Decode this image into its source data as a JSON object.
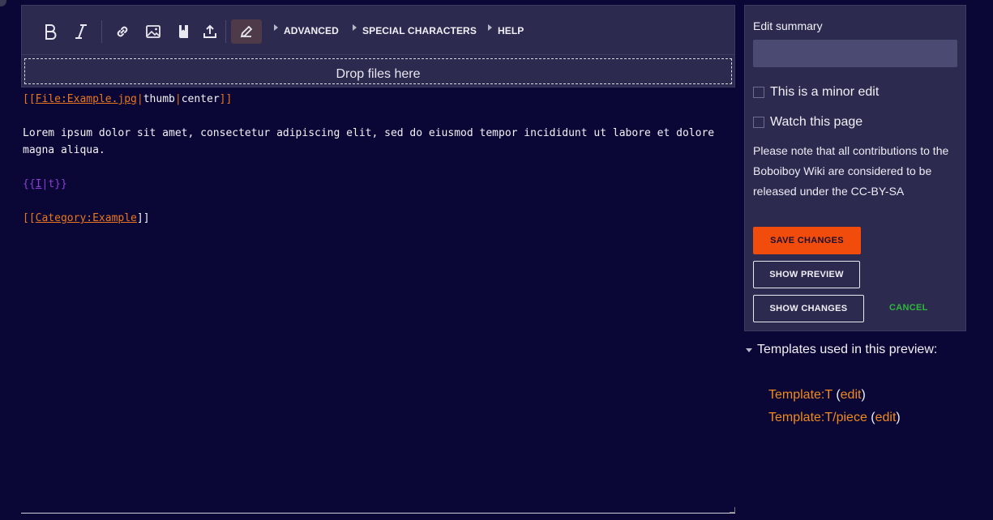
{
  "toolbar": {
    "menus": [
      "ADVANCED",
      "SPECIAL CHARACTERS",
      "HELP"
    ],
    "drop_text": "Drop files here"
  },
  "editor": {
    "line1": {
      "open": "[[",
      "link": "File:Example.jpg",
      "pipe1": "|",
      "param1": "thumb",
      "pipe2": "|",
      "param2": "center",
      "close": "]]"
    },
    "paragraph": "Lorem ipsum dolor sit amet, consectetur adipiscing elit, sed do eiusmod tempor incididunt ut labore et dolore magna aliqua.",
    "template": {
      "open": "{{",
      "name": "I",
      "pipe": "|",
      "param": "t",
      "close": "}}"
    },
    "category": {
      "open": "[[",
      "link": "Category:Example",
      "close": "]]"
    }
  },
  "panel": {
    "summary_label": "Edit summary",
    "summary_value": "",
    "minor_edit": "This is a minor edit",
    "watch_page": "Watch this page",
    "note": "Please note that all contributions to the Boboiboy Wiki are considered to be released under the CC-BY-SA",
    "save_label": "SAVE CHANGES",
    "preview_label": "SHOW PREVIEW",
    "changes_label": "SHOW CHANGES",
    "cancel_label": "CANCEL"
  },
  "templates": {
    "heading": "Templates used in this preview:",
    "items": [
      {
        "name": "Template:T",
        "open": "(",
        "edit": "edit",
        "close": ")"
      },
      {
        "name": "Template:T/piece",
        "open": "(",
        "edit": "edit",
        "close": ")"
      }
    ]
  },
  "colors": {
    "background": "#0a0736",
    "panel": "#2c2a4f",
    "accent_orange": "#f24c0d",
    "link_orange": "#e8761f",
    "template_purple": "#8b3fd6",
    "cancel_green": "#2fb83b"
  },
  "icons": [
    "bold-icon",
    "italic-icon",
    "link-icon",
    "image-icon",
    "book-icon",
    "upload-icon",
    "pencil-icon"
  ]
}
